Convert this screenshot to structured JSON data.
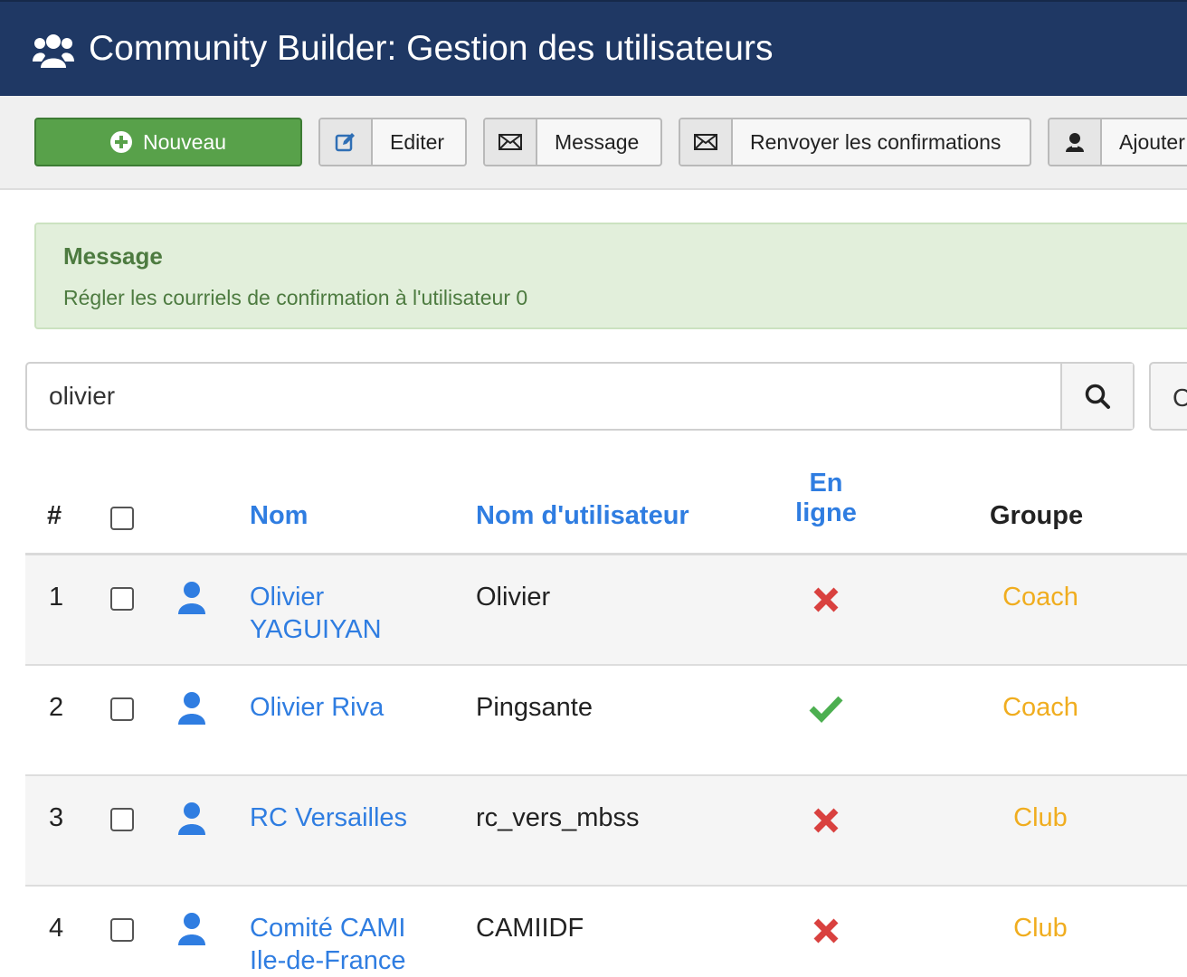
{
  "header": {
    "title": "Community Builder: Gestion des utilisateurs",
    "icon": "users-icon"
  },
  "toolbar": {
    "new_label": "Nouveau",
    "edit_label": "Editer",
    "message_label": "Message",
    "resend_label": "Renvoyer les confirmations",
    "add_label": "Ajouter"
  },
  "alert": {
    "title": "Message",
    "text": "Régler les courriels de confirmation à l'utilisateur 0"
  },
  "search": {
    "value": "olivier",
    "clear_label": "C"
  },
  "table": {
    "headers": {
      "num": "#",
      "name": "Nom",
      "username": "Nom d'utilisateur",
      "online_line1": "En",
      "online_line2": "ligne",
      "group": "Groupe"
    },
    "rows": [
      {
        "num": "1",
        "name": "Olivier YAGUIYAN",
        "username": "Olivier",
        "online": false,
        "group": "Coach"
      },
      {
        "num": "2",
        "name": "Olivier Riva",
        "username": "Pingsante",
        "online": true,
        "group": "Coach"
      },
      {
        "num": "3",
        "name": "RC Versailles",
        "username": "rc_vers_mbss",
        "online": false,
        "group": "Club"
      },
      {
        "num": "4",
        "name": "Comité CAMI Ile-de-France",
        "username": "CAMIIDF",
        "online": false,
        "group": "Club"
      }
    ]
  },
  "colors": {
    "header_bg": "#1f3864",
    "link": "#2f7de1",
    "group": "#f0ad1f",
    "online": "#4caf50",
    "offline": "#d9413f",
    "success_bg": "#e2efdb"
  }
}
